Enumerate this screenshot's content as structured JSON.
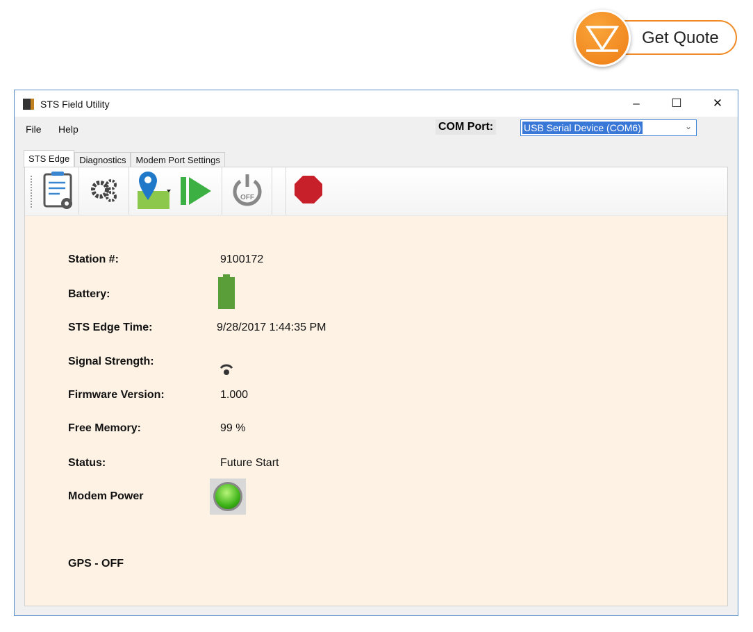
{
  "quote_button": {
    "label": "Get Quote"
  },
  "window": {
    "title": "STS Field Utility",
    "minimize": "–",
    "maximize": "☐",
    "close": "✕"
  },
  "menu": [
    "File",
    "Help"
  ],
  "com_port": {
    "label": "COM Port:",
    "value": "USB Serial Device (COM6)"
  },
  "tabs": [
    "STS Edge",
    "Diagnostics",
    "Modem Port Settings"
  ],
  "toolbar": {
    "power_label": "OFF"
  },
  "fields": {
    "station_label": "Station #:",
    "station": "9100172",
    "battery_label": "Battery:",
    "battery_level": 100,
    "time_label": "STS Edge Time:",
    "time": "9/28/2017 1:44:35 PM",
    "signal_label": "Signal Strength:",
    "firmware_label": "Firmware Version:",
    "firmware": "1.000",
    "memory_label": "Free Memory:",
    "memory": "99 %",
    "status_label": "Status:",
    "status": "Future Start",
    "modem_label": "Modem Power",
    "gps_label": "GPS - OFF"
  },
  "colors": {
    "accent": "#f08a24",
    "panel": "#fdf2e4",
    "battery": "#5a9e3a",
    "stop": "#c8202a"
  }
}
